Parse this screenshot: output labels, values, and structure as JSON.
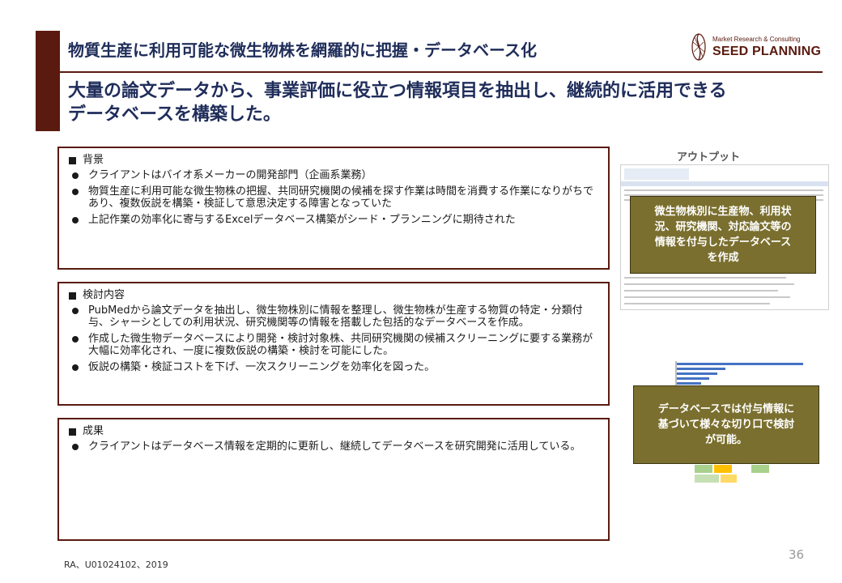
{
  "header": {
    "title": "物質生産に利用可能な微生物株を網羅的に把握・データベース化",
    "subtitle_line1": "大量の論文データから、事業評価に役立つ情報項目を抽出し、継続的に活用できる",
    "subtitle_line2": "データベースを構築した。"
  },
  "logo": {
    "tagline": "Market Research & Consulting",
    "name": "SEED PLANNING",
    "color": "#5a1a0f"
  },
  "sections": [
    {
      "heading": "背景",
      "items": [
        "クライアントはバイオ系メーカーの開発部門（企画系業務）",
        "物質生産に利用可能な微生物株の把握、共同研究機関の候補を探す作業は時間を消費する作業になりがちであり、複数仮説を構築・検証して意思決定する障害となっていた",
        "上記作業の効率化に寄与するExcelデータベース構築がシード・プランニングに期待された"
      ]
    },
    {
      "heading": "検討内容",
      "items": [
        "PubMedから論文データを抽出し、微生物株別に情報を整理し、微生物株が生産する物質の特定・分類付与、シャーシとしての利用状況、研究機関等の情報を搭載した包括的なデータベースを作成。",
        "作成した微生物データベースにより開発・検討対象株、共同研究機関の候補スクリーニングに要する業務が大幅に効率化され、一度に複数仮説の構築・検討を可能にした。",
        "仮説の構築・検証コストを下げ、一次スクリーニングを効率化を図った。"
      ]
    },
    {
      "heading": "成果",
      "items": [
        "クライアントはデータベース情報を定期的に更新し、継続してデータベースを研究開発に活用している。"
      ]
    }
  ],
  "output": {
    "label": "アウトプット",
    "callout1": [
      "微生物株別に生産物、利用状",
      "況、研究機関、対応論文等の",
      "情報を付与したデータベース",
      "を作成"
    ],
    "callout2": [
      "データベースでは付与情報に",
      "基づいて様々な切り口で検討",
      "が可能。"
    ]
  },
  "footer": {
    "source": "RA、U01024102、2019",
    "page": "36"
  },
  "colors": {
    "accent": "#5a1a0f",
    "title_text": "#1f2d5a",
    "callout_bg": "#7a6f2e",
    "bar_blue": "#4472c4"
  }
}
